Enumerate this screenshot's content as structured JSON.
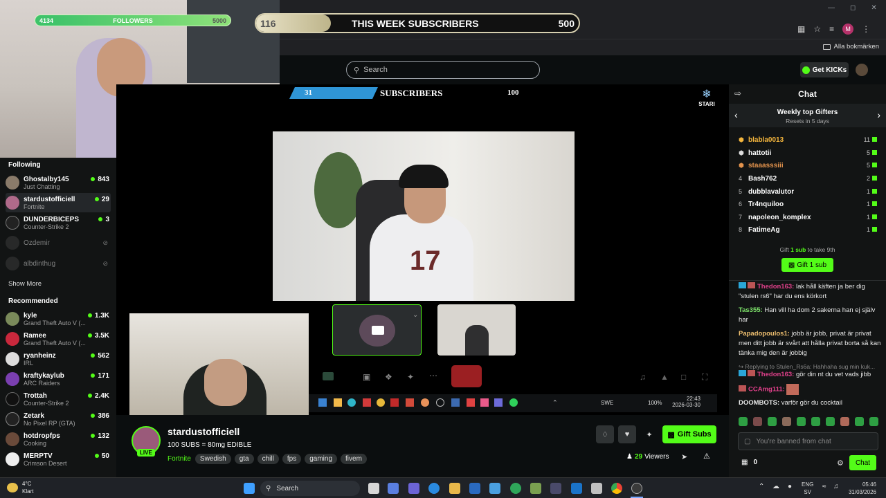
{
  "overlays": {
    "followers": {
      "current": "4134",
      "label": "FOLLOWERS",
      "goal": "5000",
      "progress": 0.83
    },
    "week_subs": {
      "current": "116",
      "label": "THIS WEEK SUBSCRIBERS",
      "goal": "500",
      "progress": 0.23
    },
    "inner_subs": {
      "current": "31",
      "label": "SUBSCRIBERS",
      "goal": "100"
    },
    "stari_logo": "STARI"
  },
  "browser": {
    "bookmarks_label": "Alla bokmärken",
    "profile_initial": "M"
  },
  "header": {
    "search_placeholder": "Search",
    "get_kicks": "Get KICKs"
  },
  "sidebar": {
    "following_title": "Following",
    "following": [
      {
        "name": "Ghostalby145",
        "category": "Just Chatting",
        "viewers": "843"
      },
      {
        "name": "stardustofficiell",
        "category": "Fortnite",
        "viewers": "29"
      },
      {
        "name": "DUNDERBICEPS",
        "category": "Counter-Strike 2",
        "viewers": "3"
      },
      {
        "name": "Ozdemir",
        "category": "",
        "viewers": ""
      },
      {
        "name": "albdinthug",
        "category": "",
        "viewers": ""
      }
    ],
    "show_more": "Show More",
    "recommended_title": "Recommended",
    "recommended": [
      {
        "name": "kyle",
        "category": "Grand Theft Auto V (...",
        "viewers": "1.3K"
      },
      {
        "name": "Ramee",
        "category": "Grand Theft Auto V (...",
        "viewers": "3.5K"
      },
      {
        "name": "ryanheinz",
        "category": "IRL",
        "viewers": "562"
      },
      {
        "name": "kraftykaylub",
        "category": "ARC Raiders",
        "viewers": "171"
      },
      {
        "name": "Trottah",
        "category": "Counter-Strike 2",
        "viewers": "2.4K"
      },
      {
        "name": "Zetark",
        "category": "No Pixel RP (GTA)",
        "viewers": "386"
      },
      {
        "name": "hotdropfps",
        "category": "Cooking",
        "viewers": "132"
      },
      {
        "name": "MERPTV",
        "category": "Crimson Desert",
        "viewers": "50"
      }
    ]
  },
  "inner_taskbar": {
    "lang": "SWE",
    "battery": "100%",
    "time": "22:43",
    "date": "2026-03-30"
  },
  "stream": {
    "channel": "stardustofficiell",
    "title": "100 SUBS = 80mg EDIBLE",
    "live": "LIVE",
    "category": "Fortnite",
    "tags": [
      "Swedish",
      "gta",
      "chill",
      "fps",
      "gaming",
      "fivem"
    ],
    "gift_subs": "Gift Subs",
    "viewers": "29",
    "viewers_label": "Viewers"
  },
  "chat": {
    "title": "Chat",
    "gifters_title": "Weekly top Gifters",
    "gifters_sub": "Resets in 5 days",
    "gifters": [
      {
        "rank": "",
        "name": "blabla0013",
        "count": "11",
        "color": "#f5b63d"
      },
      {
        "rank": "",
        "name": "hattotii",
        "count": "5",
        "color": "#ffffff"
      },
      {
        "rank": "",
        "name": "staaasssiii",
        "count": "5",
        "color": "#e3934d"
      },
      {
        "rank": "4",
        "name": "Bash762",
        "count": "2",
        "color": "#ffffff"
      },
      {
        "rank": "5",
        "name": "dubblavalutor",
        "count": "1",
        "color": "#ffffff"
      },
      {
        "rank": "6",
        "name": "Tr4nquiloo",
        "count": "1",
        "color": "#ffffff"
      },
      {
        "rank": "7",
        "name": "napoleon_komplex",
        "count": "1",
        "color": "#ffffff"
      },
      {
        "rank": "8",
        "name": "FatimeAg",
        "count": "1",
        "color": "#ffffff"
      }
    ],
    "gift_prompt_pre": "Gift",
    "gift_prompt_mid": "1 sub",
    "gift_prompt_post": "to take 9th",
    "gift_button": "Gift 1 sub",
    "messages": [
      {
        "user": "Thedon163:",
        "text": "lak håll käften ja ber dig \"stulen rs6\" har du ens körkort",
        "color": "#e0408a"
      },
      {
        "user": "Tas355:",
        "text": "Han vill ha dom 2 sakerna han ej själv har",
        "color": "#7ee36b"
      },
      {
        "user": "Papadopoulos1:",
        "text": "jobb är jobb, privat är privat men ditt jobb är svårt att hålla privat borta så kan tänka mig den är jobbig",
        "color": "#f0c070"
      },
      {
        "user": "Thedon163:",
        "text": "gör din nt du vet vads jibb",
        "color": "#e0408a"
      },
      {
        "user": "CCAmg111:",
        "text": "",
        "color": "#e0408a"
      },
      {
        "user": "DOOMBOTS:",
        "text": "varför gör du cocktail",
        "color": "#e8e8e8"
      }
    ],
    "reply_text": "Replying to Stulen_Rs6a: Hahhaha sug min kuk...",
    "banned_placeholder": "You're banned from chat",
    "points": "0",
    "send": "Chat"
  },
  "taskbar": {
    "weather_temp": "4°C",
    "weather_text": "Klart",
    "search": "Search",
    "lang": "ENG",
    "lang2": "SV",
    "time": "05:46",
    "date": "31/03/2026"
  },
  "colors": {
    "accent": "#53fc18",
    "bg": "#0b0e0f",
    "panel": "#121414"
  }
}
